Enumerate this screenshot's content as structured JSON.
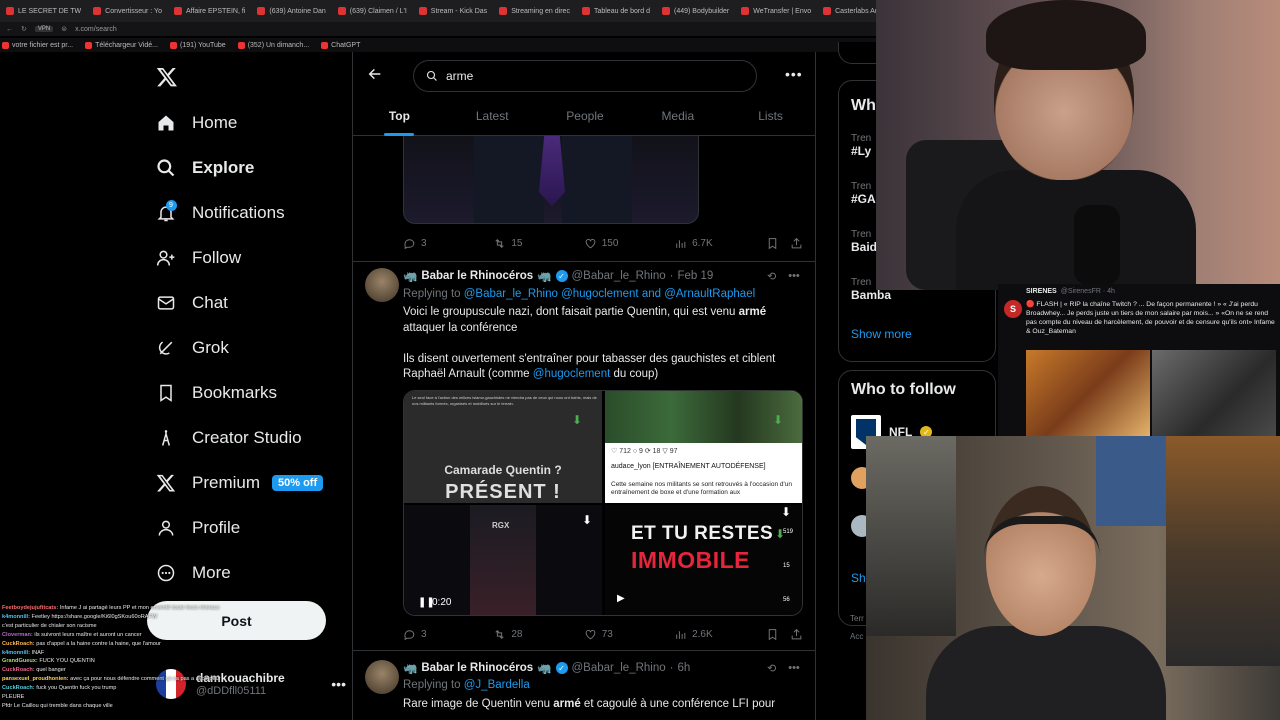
{
  "browser": {
    "tabs": [
      "LE SECRET DE TW",
      "Convertisseur : Yo",
      "Affaire EPSTEIN, fi",
      "(639) Antoine Dan",
      "(639) Claimen / L'I",
      "Stream - Kick Das",
      "Streaming en direc",
      "Tableau de bord d",
      "(449) Bodybuilder",
      "WeTransfer | Envo",
      "Casterlabs Auth"
    ],
    "url": "x.com/search",
    "url_badge": "VPN",
    "bookmarks": [
      "votre fichier est pr...",
      "Téléchargeur Vidé...",
      "(191) YouTube",
      "(352) Un dimanch...",
      "ChatGPT"
    ]
  },
  "sidebar": {
    "items": [
      {
        "label": "Home",
        "icon": "home-icon"
      },
      {
        "label": "Explore",
        "icon": "search-icon"
      },
      {
        "label": "Notifications",
        "icon": "bell-icon",
        "badge": "9"
      },
      {
        "label": "Follow",
        "icon": "person-add-icon"
      },
      {
        "label": "Chat",
        "icon": "mail-icon"
      },
      {
        "label": "Grok",
        "icon": "grok-icon"
      },
      {
        "label": "Bookmarks",
        "icon": "bookmark-icon"
      },
      {
        "label": "Creator Studio",
        "icon": "creator-studio-icon"
      },
      {
        "label": "Premium",
        "icon": "x-logo-icon",
        "badge": "50% off"
      },
      {
        "label": "Profile",
        "icon": "person-icon"
      },
      {
        "label": "More",
        "icon": "more-circle-icon"
      }
    ],
    "post_label": "Post",
    "account": {
      "name": "damkouachibre",
      "handle": "@dDDfll05111"
    }
  },
  "chat": [
    {
      "user": "Feetboydejujufitcats:",
      "msg": "Infame J ai partagé leurs PP et mon enventé toute leurs réseaux"
    },
    {
      "user": "k4monnill:",
      "msg": "Feetley https://share.google/Ki6l0gSKou60oRAFW"
    },
    {
      "user": "",
      "msg": "c'est particulier de chialer son racisme"
    },
    {
      "user": "Cloverman:",
      "msg": "ils suivront leurs maître et auront un cancer"
    },
    {
      "user": "CuckRoach:",
      "msg": "pas d'appel a la haine contre la haine, que l'amour"
    },
    {
      "user": "k4monnill:",
      "msg": "INAF"
    },
    {
      "user": "GrandGueux:",
      "msg": "FUCK YOU QUENTIN"
    },
    {
      "user": "CuckRoach:",
      "msg": "quel banger"
    },
    {
      "user": "pansexuel_proudhonien:",
      "msg": "avec ça pour nous défendre comment ça va pas a avoir peur"
    },
    {
      "user": "CuckRoach:",
      "msg": "fuck you Quentin fuck you trump"
    },
    {
      "user": "",
      "msg": "PLEURE"
    },
    {
      "user": "",
      "msg": "Pfdr Le Caillou qui tremble dans chaque ville"
    }
  ],
  "search": {
    "query": "arme"
  },
  "tabs": [
    "Top",
    "Latest",
    "People",
    "Media",
    "Lists"
  ],
  "prev_tweet_stats": {
    "replies": "3",
    "reposts": "15",
    "likes": "150",
    "views": "6.7K"
  },
  "tweet1": {
    "name": "Babar le Rhinocéros",
    "handle": "@Babar_le_Rhino",
    "date": "Feb 19",
    "replying_label": "Replying to",
    "replying_to": "@Babar_le_Rhino @hugoclement and @ArnaultRaphael",
    "text1a": "Voici le groupuscule nazi, dont faisait partie Quentin, qui est venu ",
    "text1b": "armé",
    "text1c": "attaquer la conférence",
    "text2a": "Ils disent ouvertement s'entraîner pour tabasser des gauchistes et ciblent Raphaël Arnault (comme ",
    "text2b": "@hugoclement",
    "text2c": " du coup)",
    "media1": {
      "small_text": "Le seul face à l'action des milices islamo-gauchistes ne viendra pas de ceux qui nous ont trahis, mais de nos militants formés, organisés et mobilisés sur le terrain.",
      "title": "Camarade Quentin ?",
      "big": "PRÉSENT !"
    },
    "media2": {
      "counts": "♡ 712  ○ 9  ⟳ 18  ▽ 97",
      "user": "audace_lyon",
      "user_tag": "[ENTRAÎNEMENT AUTODÉFENSE]",
      "caption": "Cette semaine nos militants se sont retrouvés à l'occasion d'un entraînement de boxe et d'une formation aux"
    },
    "media3": {
      "label": "RGX",
      "time": "0:20"
    },
    "media4": {
      "line1": "ET TU RESTES",
      "line2": "IMMOBILE",
      "c1": "519",
      "c2": "15",
      "c3": "56"
    },
    "stats": {
      "replies": "3",
      "reposts": "28",
      "likes": "73",
      "views": "2.6K"
    }
  },
  "tweet2": {
    "name": "Babar le Rhinocéros",
    "handle": "@Babar_le_Rhino",
    "date": "6h",
    "replying_label": "Replying to",
    "replying_to": "@J_Bardella",
    "text_a": "Rare image de Quentin venu ",
    "text_b": "armé",
    "text_c": " et cagoulé à une conférence LFI pour"
  },
  "right": {
    "whats_happening": "Wh",
    "trends": [
      {
        "label": "Tren",
        "name": "#Ly"
      },
      {
        "label": "Tren",
        "name": "#GA"
      },
      {
        "label": "Tren",
        "name": "Baid"
      },
      {
        "label": "Tren",
        "name": "Bamba"
      }
    ],
    "show_more": "Show more",
    "who_to_follow": "Who to follow",
    "suggest_name": "NFL",
    "show_more2": "Sho",
    "footer1": "Terr",
    "footer2": "Acc"
  },
  "notification": {
    "account": "SIRENES",
    "handle": "@SirenesFR · 4h",
    "avatar_letter": "S",
    "text": "🔴 FLASH | « RIP la chaîne Twitch ? ... De façon permanente ! » « J'ai perdu Broadwhey... Je perds juste un tiers de mon salaire par mois... » «On ne se rend pas compte du niveau de harcèlement, de pouvoir et de censure qu'ils ont» Infame & Ouz_Bateman"
  },
  "colors": {
    "accent": "#1d9bf0",
    "bg": "#000000",
    "text": "#e7e9ea",
    "muted": "#71767b",
    "border": "#2f3336"
  }
}
